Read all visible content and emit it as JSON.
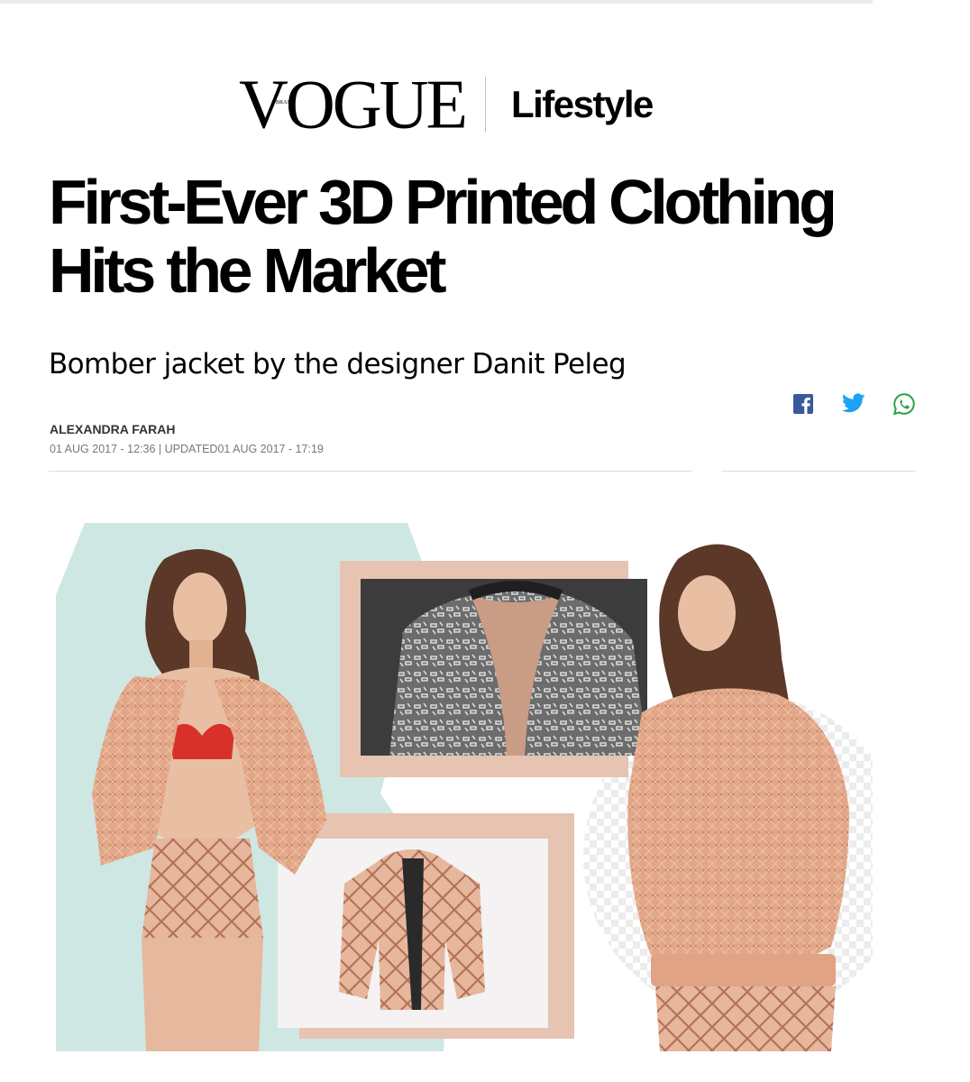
{
  "brand": {
    "logo_text": "VOGUE",
    "logo_subtext": "BRASIL",
    "section": "Lifestyle"
  },
  "article": {
    "headline_line1": "First-Ever 3D Printed Clothing",
    "headline_line2": "Hits the Market",
    "subheadline": "Bomber jacket by the designer Danit Peleg",
    "author": "ALEXANDRA FARAH",
    "dateline": "01 AUG 2017 - 12:36 | UPDATED01 AUG 2017 - 17:19"
  },
  "share": [
    {
      "icon": "facebook-icon",
      "color": "#3b5998"
    },
    {
      "icon": "twitter-icon",
      "color": "#1da1f2"
    },
    {
      "icon": "whatsapp-icon",
      "color": "#25a244"
    }
  ],
  "hero_image": {
    "colors": {
      "mint": "#cfe7e2",
      "salmon": "#e7c3b2",
      "knit": "#e0a385",
      "bra": "#d8312b",
      "jacket_gray": "#8a8a8a",
      "hair": "#5b3827"
    }
  }
}
